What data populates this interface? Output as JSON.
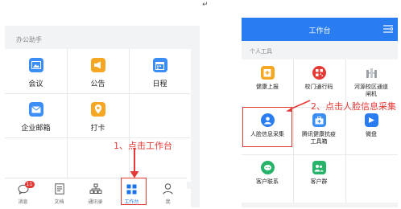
{
  "return_mark": "↵",
  "left_phone": {
    "section_title": "办公助手",
    "apps": [
      {
        "label": "会议",
        "icon": "image-icon",
        "color": "#3a8ef6"
      },
      {
        "label": "公告",
        "icon": "megaphone-icon",
        "color": "#f5a623"
      },
      {
        "label": "日程",
        "icon": "calendar-icon",
        "color": "#3a8ef6"
      },
      {
        "label": "企业邮箱",
        "icon": "mail-icon",
        "color": "#3a8ef6"
      },
      {
        "label": "打卡",
        "icon": "location-pin-icon",
        "color": "#f5a623"
      }
    ],
    "tabbar": [
      {
        "label": "消息",
        "icon": "message-icon",
        "badge": "11"
      },
      {
        "label": "文档",
        "icon": "document-icon"
      },
      {
        "label": "通讯录",
        "icon": "contacts-icon"
      },
      {
        "label": "工作台",
        "icon": "workbench-icon",
        "active": true
      },
      {
        "label": "我",
        "icon": "person-icon"
      }
    ]
  },
  "right_phone": {
    "header_title": "工作台",
    "section_title": "个人工具",
    "apps": [
      {
        "label": "健康上报",
        "icon": "health-report-icon",
        "color": "#f5a623"
      },
      {
        "label": "校门通行码",
        "icon": "qr-pass-icon",
        "color": "#e53935"
      },
      {
        "label": "河源校区通道\n闸机",
        "icon": "gate-icon",
        "color": "#9aa0a6"
      },
      {
        "label": "人脸信息采集",
        "icon": "face-collect-icon",
        "color": "#2a7df1"
      },
      {
        "label": "腾讯健康抗疫\n工具箱",
        "icon": "toolbox-icon",
        "color": "#3a8ef6"
      },
      {
        "label": "微盘",
        "icon": "cloud-drive-icon",
        "color": "#2a7df1"
      },
      {
        "label": "客户联系",
        "icon": "customer-contact-icon",
        "color": "#27b36a"
      },
      {
        "label": "客户群",
        "icon": "customer-group-icon",
        "color": "#27b36a"
      }
    ]
  },
  "annotations": {
    "step1": "1、点击工作台",
    "step2": "2、点击人脸信息采集"
  },
  "colors": {
    "accent": "#2a7df1",
    "annotation_red": "#e53935"
  }
}
